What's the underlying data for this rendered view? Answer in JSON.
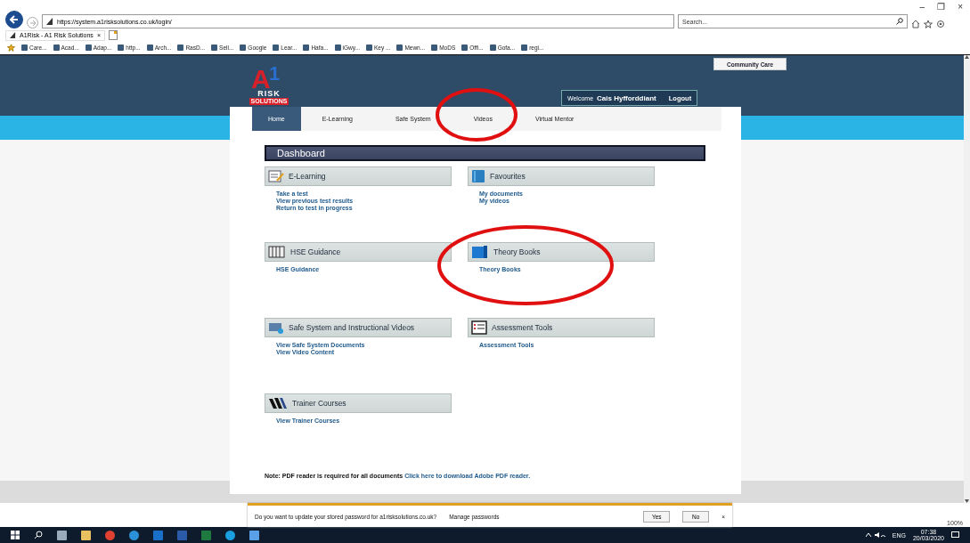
{
  "browser": {
    "url": "https://system.a1risksolutions.co.uk/login/",
    "search_placeholder": "Search...",
    "tab_title": "A1Risk - A1 Risk Solutions",
    "tab_close": "×",
    "window_controls": [
      "–",
      "❐",
      "×"
    ],
    "favourites": [
      "Care...",
      "Acad...",
      "Adap...",
      "http...",
      "Arch...",
      "RasD...",
      "Sell...",
      "Google",
      "Lear...",
      "Hafa...",
      "iGwy...",
      "Key ...",
      "Mewn...",
      "MoDS",
      "Offi...",
      "Gofa...",
      "regi..."
    ]
  },
  "site": {
    "logo": {
      "letter": "A",
      "digit": "1",
      "word": "RISK",
      "tagline": "SOLUTIONS"
    },
    "community_button": "Community Care",
    "welcome": "Welcome",
    "user": "Cais Hyfforddiant",
    "logout": "Logout",
    "nav": [
      {
        "label": "Home",
        "selected": true
      },
      {
        "label": "E-Learning",
        "selected": false
      },
      {
        "label": "Safe System",
        "selected": false
      },
      {
        "label": "Videos",
        "selected": false
      },
      {
        "label": "Virtual Mentor",
        "selected": false
      }
    ],
    "dashboard_title": "Dashboard",
    "sections": [
      {
        "title": "E-Learning",
        "kind": "elearning",
        "links": [
          "Take a test",
          "View previous test results",
          "Return to test in progress"
        ]
      },
      {
        "title": "Favourites",
        "kind": "favourites",
        "links": [
          "My documents",
          "My videos"
        ]
      },
      {
        "title": "HSE Guidance",
        "kind": "guidance",
        "links": [
          "HSE Guidance"
        ]
      },
      {
        "title": "Theory Books",
        "kind": "books",
        "links": [
          "Theory Books"
        ]
      },
      {
        "title": "Safe System and Instructional Videos",
        "kind": "videos",
        "links": [
          "View Safe System Documents",
          "View Video Content"
        ]
      },
      {
        "title": "Assessment Tools",
        "kind": "assessment",
        "links": [
          "Assessment Tools"
        ]
      },
      {
        "title": "Trainer Courses",
        "kind": "courses",
        "links": [
          "View Trainer Courses"
        ]
      }
    ],
    "note": "Note: PDF reader is required for all documents",
    "note_link": "Click here to download Adobe PDF reader."
  },
  "password_bar": {
    "message": "Do you want to update your stored password for a1risksolutions.co.uk?",
    "manage": "Manage passwords",
    "buttons": [
      "Yes",
      "No"
    ],
    "close": "×"
  },
  "zoom": "100%",
  "taskbar": {
    "language": "ENG",
    "time": "07:38",
    "date": "20/03/2020"
  }
}
